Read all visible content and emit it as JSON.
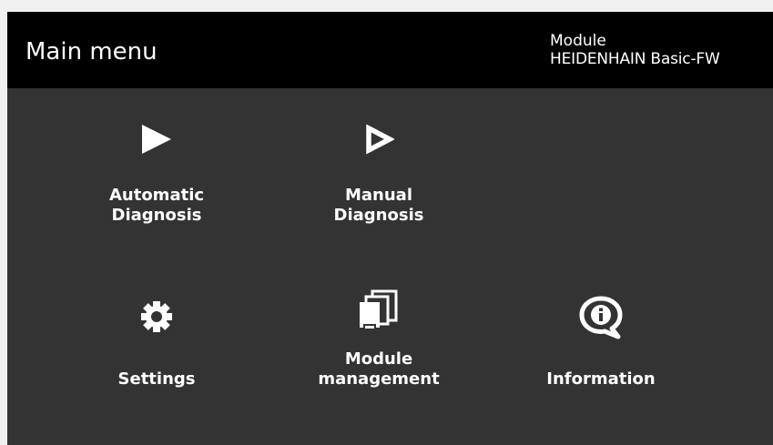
{
  "header": {
    "title": "Main menu",
    "module_label": "Module",
    "module_name": "HEIDENHAIN Basic-FW"
  },
  "menu": {
    "automatic": {
      "line1": "Automatic",
      "line2": "Diagnosis",
      "icon": "play-filled-icon"
    },
    "manual": {
      "line1": "Manual",
      "line2": "Diagnosis",
      "icon": "play-outline-icon"
    },
    "settings": {
      "line1": "Settings",
      "icon": "gear-icon"
    },
    "module_mgmt": {
      "line1": "Module",
      "line2": "management",
      "icon": "module-stack-icon"
    },
    "information": {
      "line1": "Information",
      "icon": "info-bubble-icon"
    }
  },
  "colors": {
    "background": "#333333",
    "header": "#000000",
    "text": "#ffffff"
  }
}
